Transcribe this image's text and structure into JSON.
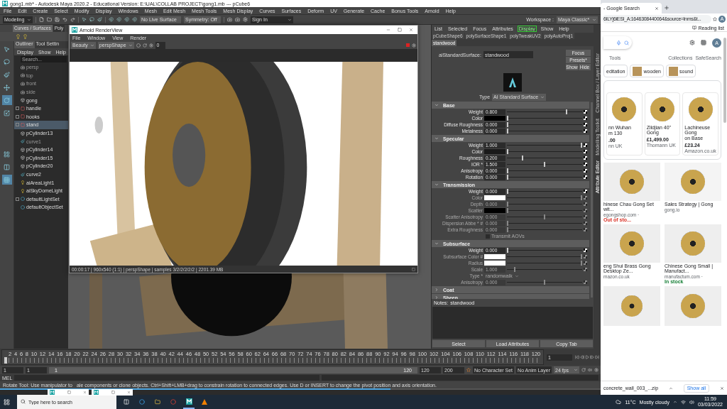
{
  "maya": {
    "title": "gong1.mb* - Autodesk Maya 2020.2 - Educational Version: E:\\UAL\\COLLAB PROJECT\\gong1.mb  ---  pCube6",
    "menus": [
      "File",
      "Edit",
      "Create",
      "Select",
      "Modify",
      "Display",
      "Windows",
      "Mesh",
      "Edit Mesh",
      "Mesh Tools",
      "Mesh Display",
      "Curves",
      "Surfaces",
      "Deform",
      "UV",
      "Generate",
      "Cache",
      "Bonus Tools",
      "Arnold",
      "Help"
    ],
    "shelf": {
      "mode": "Modeling",
      "live_surface": "No Live Surface",
      "symmetry": "Symmetry: Off",
      "sign_in": "Sign In",
      "workspace_label": "Workspace :",
      "workspace": "Maya Classic*"
    },
    "shelf_tabs": [
      {
        "label": "Curves / Surfaces",
        "selected": true
      },
      {
        "label": "Poly",
        "selected": false
      }
    ],
    "outliner": {
      "tabs": [
        {
          "label": "Outliner",
          "selected": true
        },
        {
          "label": "Tool Settin",
          "selected": false
        }
      ],
      "menus": [
        "Display",
        "Show",
        "Help"
      ],
      "search": {
        "placeholder": "Search..."
      },
      "items": [
        {
          "label": "persp",
          "kind": "camera",
          "dimmed": true,
          "selected": false
        },
        {
          "label": "top",
          "kind": "camera",
          "dimmed": true,
          "selected": false
        },
        {
          "label": "front",
          "kind": "camera",
          "dimmed": true,
          "selected": false
        },
        {
          "label": "side",
          "kind": "camera",
          "dimmed": true,
          "selected": false
        },
        {
          "label": "gong",
          "kind": "mesh",
          "dimmed": false,
          "selected": false
        },
        {
          "label": "handle",
          "kind": "group",
          "dimmed": false,
          "selected": false,
          "expanded": false
        },
        {
          "label": "hooks",
          "kind": "group",
          "dimmed": false,
          "selected": false,
          "expanded": false
        },
        {
          "label": "stand",
          "kind": "group",
          "dimmed": false,
          "selected": true,
          "expanded": false
        },
        {
          "label": "pCylinder13",
          "kind": "mesh",
          "dimmed": false,
          "selected": false
        },
        {
          "label": "curve1",
          "kind": "curve",
          "dimmed": true,
          "selected": false
        },
        {
          "label": "pCylinder14",
          "kind": "mesh",
          "dimmed": false,
          "selected": false
        },
        {
          "label": "pCylinder15",
          "kind": "mesh",
          "dimmed": false,
          "selected": false
        },
        {
          "label": "pCylinder20",
          "kind": "mesh",
          "dimmed": false,
          "selected": false
        },
        {
          "label": "curve2",
          "kind": "curve",
          "dimmed": false,
          "selected": false
        },
        {
          "label": "aiAreaLight1",
          "kind": "light",
          "dimmed": false,
          "selected": false
        },
        {
          "label": "aiSkyDomeLight",
          "kind": "light",
          "dimmed": false,
          "selected": false
        },
        {
          "label": "defaultLightSet",
          "kind": "set",
          "dimmed": false,
          "selected": false,
          "expanded": false
        },
        {
          "label": "defaultObjectSet",
          "kind": "set",
          "dimmed": false,
          "selected": false
        }
      ]
    },
    "render_view": {
      "title": "Arnold RenderView",
      "menus": [
        "File",
        "Window",
        "View",
        "Render"
      ],
      "aov": "Beauty",
      "camera": "perspShape",
      "exposure": "0",
      "status": "00:00:17 | 960x540 (1:1) | perspShape | samples 3/2/2/2/2/2 | 2201.39 MB"
    },
    "attribute_editor": {
      "menus": [
        {
          "label": "List",
          "selected": false
        },
        {
          "label": "Selected",
          "selected": false
        },
        {
          "label": "Focus",
          "selected": false
        },
        {
          "label": "Attributes",
          "selected": false
        },
        {
          "label": "Display",
          "selected": true
        },
        {
          "label": "Show",
          "selected": false
        },
        {
          "label": "Help",
          "selected": false
        }
      ],
      "tabs": [
        {
          "label": "pCubeShape6",
          "selected": false
        },
        {
          "label": "polySurfaceShape1",
          "selected": false
        },
        {
          "label": "polyTweakUV2",
          "selected": false
        },
        {
          "label": "polyAutoProj1",
          "selected": false
        },
        {
          "label": "standwood",
          "selected": true
        }
      ],
      "node_type": "aiStandardSurface:",
      "node_name": "standwood",
      "buttons": [
        "Focus",
        "Presets*",
        "Show",
        "Hide"
      ],
      "type_label": "Type",
      "type": "AI Standard Surface",
      "sections": [
        {
          "title": "Base",
          "expanded": true,
          "rows": [
            {
              "kind": "number",
              "label": "Weight",
              "value": "0.800",
              "level": 0.8,
              "disabled": false
            },
            {
              "kind": "color",
              "label": "Color",
              "color": "#000000",
              "level": 0,
              "disabled": false
            },
            {
              "kind": "number",
              "label": "Diffuse Roughness",
              "value": "0.000",
              "level": 0,
              "disabled": false
            },
            {
              "kind": "number",
              "label": "Metalness",
              "value": "0.000",
              "level": 0,
              "disabled": false
            }
          ]
        },
        {
          "title": "Specular",
          "expanded": true,
          "rows": [
            {
              "kind": "number",
              "label": "Weight",
              "value": "1.000",
              "level": 1,
              "disabled": false
            },
            {
              "kind": "color",
              "label": "Color",
              "color": "#1a1a1a",
              "level": 0,
              "disabled": false
            },
            {
              "kind": "number",
              "label": "Roughness",
              "value": "0.200",
              "level": 0.2,
              "disabled": false
            },
            {
              "kind": "number",
              "label": "IOR *",
              "value": "1.500",
              "level": 0.5,
              "disabled": false
            },
            {
              "kind": "number",
              "label": "Anisotropy",
              "value": "0.000",
              "level": 0,
              "disabled": false
            },
            {
              "kind": "number",
              "label": "Rotation",
              "value": "0.000",
              "level": 0,
              "disabled": false
            }
          ]
        },
        {
          "title": "Transmission",
          "expanded": true,
          "rows": [
            {
              "kind": "number",
              "label": "Weight",
              "value": "0.000",
              "level": 0,
              "disabled": false
            },
            {
              "kind": "color",
              "label": "Color",
              "color": "#ffffff",
              "level": 1,
              "disabled": true
            },
            {
              "kind": "number",
              "label": "Depth",
              "value": "0.000",
              "level": 0,
              "disabled": true
            },
            {
              "kind": "color",
              "label": "Scatter",
              "color": "#000000",
              "level": 0,
              "disabled": true
            },
            {
              "kind": "number",
              "label": "Scatter Anisotropy",
              "value": "0.000",
              "level": 0.5,
              "disabled": true
            },
            {
              "kind": "number",
              "label": "Dispersion Abbe * #",
              "value": "0.000",
              "level": 0,
              "disabled": true
            },
            {
              "kind": "number",
              "label": "Extra Roughness",
              "value": "0.000",
              "level": 0,
              "disabled": true
            },
            {
              "kind": "checkbox",
              "label": "Transmit AOVs",
              "checked": false,
              "disabled": true
            }
          ]
        },
        {
          "title": "Subsurface",
          "expanded": true,
          "rows": [
            {
              "kind": "number",
              "label": "Weight",
              "value": "0.000",
              "level": 0,
              "disabled": false
            },
            {
              "kind": "color",
              "label": "Subsurface Color #",
              "color": "#ffffff",
              "level": 1,
              "disabled": true
            },
            {
              "kind": "color",
              "label": "Radius",
              "color": "#ffffff",
              "level": 1,
              "disabled": true
            },
            {
              "kind": "number",
              "label": "Scale",
              "value": "1.000",
              "level": 0.1,
              "disabled": true
            },
            {
              "kind": "dropdown",
              "label": "Type *",
              "value": "randomwalk",
              "disabled": true
            },
            {
              "kind": "number",
              "label": "Anisotropy",
              "value": "0.000",
              "level": 0.5,
              "disabled": true
            }
          ]
        },
        {
          "title": "Coat",
          "expanded": false
        },
        {
          "title": "Sheen",
          "expanded": false
        }
      ],
      "notes_label": "Notes:",
      "notes": "standwood",
      "footer_buttons": [
        "Select",
        "Load Attributes",
        "Copy Tab"
      ]
    },
    "side_tabs": [
      "Channel Box / Layer Editor",
      "Modelling Toolkit",
      "Attribute Editor"
    ],
    "timeline": {
      "ticks": [
        "2",
        "4",
        "6",
        "8",
        "10",
        "12",
        "14",
        "16",
        "18",
        "20",
        "22",
        "24",
        "26",
        "28",
        "30",
        "32",
        "34",
        "36",
        "38",
        "40",
        "42",
        "44",
        "46",
        "48",
        "50",
        "52",
        "54",
        "56",
        "58",
        "60",
        "62",
        "64",
        "66",
        "68",
        "70",
        "72",
        "74",
        "76",
        "78",
        "80",
        "82",
        "84",
        "86",
        "88",
        "90",
        "92",
        "94",
        "96",
        "98",
        "100",
        "102",
        "104",
        "106",
        "108",
        "110",
        "112",
        "114",
        "116",
        "118",
        "120"
      ],
      "current_frame": "1",
      "level": 0
    },
    "range": {
      "start": "1",
      "playback_start": "1",
      "slider_start": "1",
      "slider_end": "120",
      "playback_end": "120",
      "end": "200",
      "level": 1,
      "character_set": "No Character Set",
      "anim_layer": "No Anim Layer",
      "fps": "24 fps"
    },
    "command_line": {
      "label": "MEL"
    },
    "help_line": [
      "Rotate Tool: Use manipulator to",
      "ale components or clone objects. Ctrl+Shift+LMB+drag to constrain rotation to connected edges. Use D or INSERT to change the pivot position and axis orientation."
    ]
  },
  "browser": {
    "tab_title": "- Google Search",
    "url": "6ILYj6iESI_A:1646308440064&source=lnms&t...",
    "profile_avatar": "A",
    "account_avatar": "A",
    "reading_list": "Reading list",
    "tools": "Tools",
    "collections": "Collections",
    "safesearch": "SafeSearch",
    "chips": [
      "editation",
      "wooden",
      "sound"
    ],
    "products": [
      {
        "title_lines": [
          "nn Wuhan",
          "m 130"
        ],
        "price": ".00",
        "seller": "nn UK"
      },
      {
        "title_lines": [
          "Zildjian 40\" Gong"
        ],
        "price": "£1,499.00",
        "seller": "Thomann UK"
      },
      {
        "title_lines": [
          "Lachineuse Gong",
          "on Base"
        ],
        "price": "£23.24",
        "seller": "Amazon.co.uk"
      }
    ],
    "images": [
      {
        "title": "hinese Chau Gong Set wit...",
        "source": "egongshop.com · ",
        "stock": "Out of sto...",
        "color": "#d93025"
      },
      {
        "title": "Sales Strategy | Gong",
        "source": "gong.io"
      },
      {
        "title": "eng Shui Brass Gong Desktop Ze...",
        "source": "mazon.co.uk"
      },
      {
        "title": "Chinese Gong Small | Manufact...",
        "source": "manufactum.com · ",
        "stock": "In stock",
        "color": "#188038"
      }
    ],
    "download": {
      "file": "concrete_wall_003_...zip",
      "show_all": "Show all"
    }
  },
  "taskbar": {
    "search": {
      "placeholder": "Type here to search"
    },
    "temperature": "11°C",
    "weather": "Mostly cloudy",
    "time": "11:59",
    "date": "03/03/2022"
  }
}
